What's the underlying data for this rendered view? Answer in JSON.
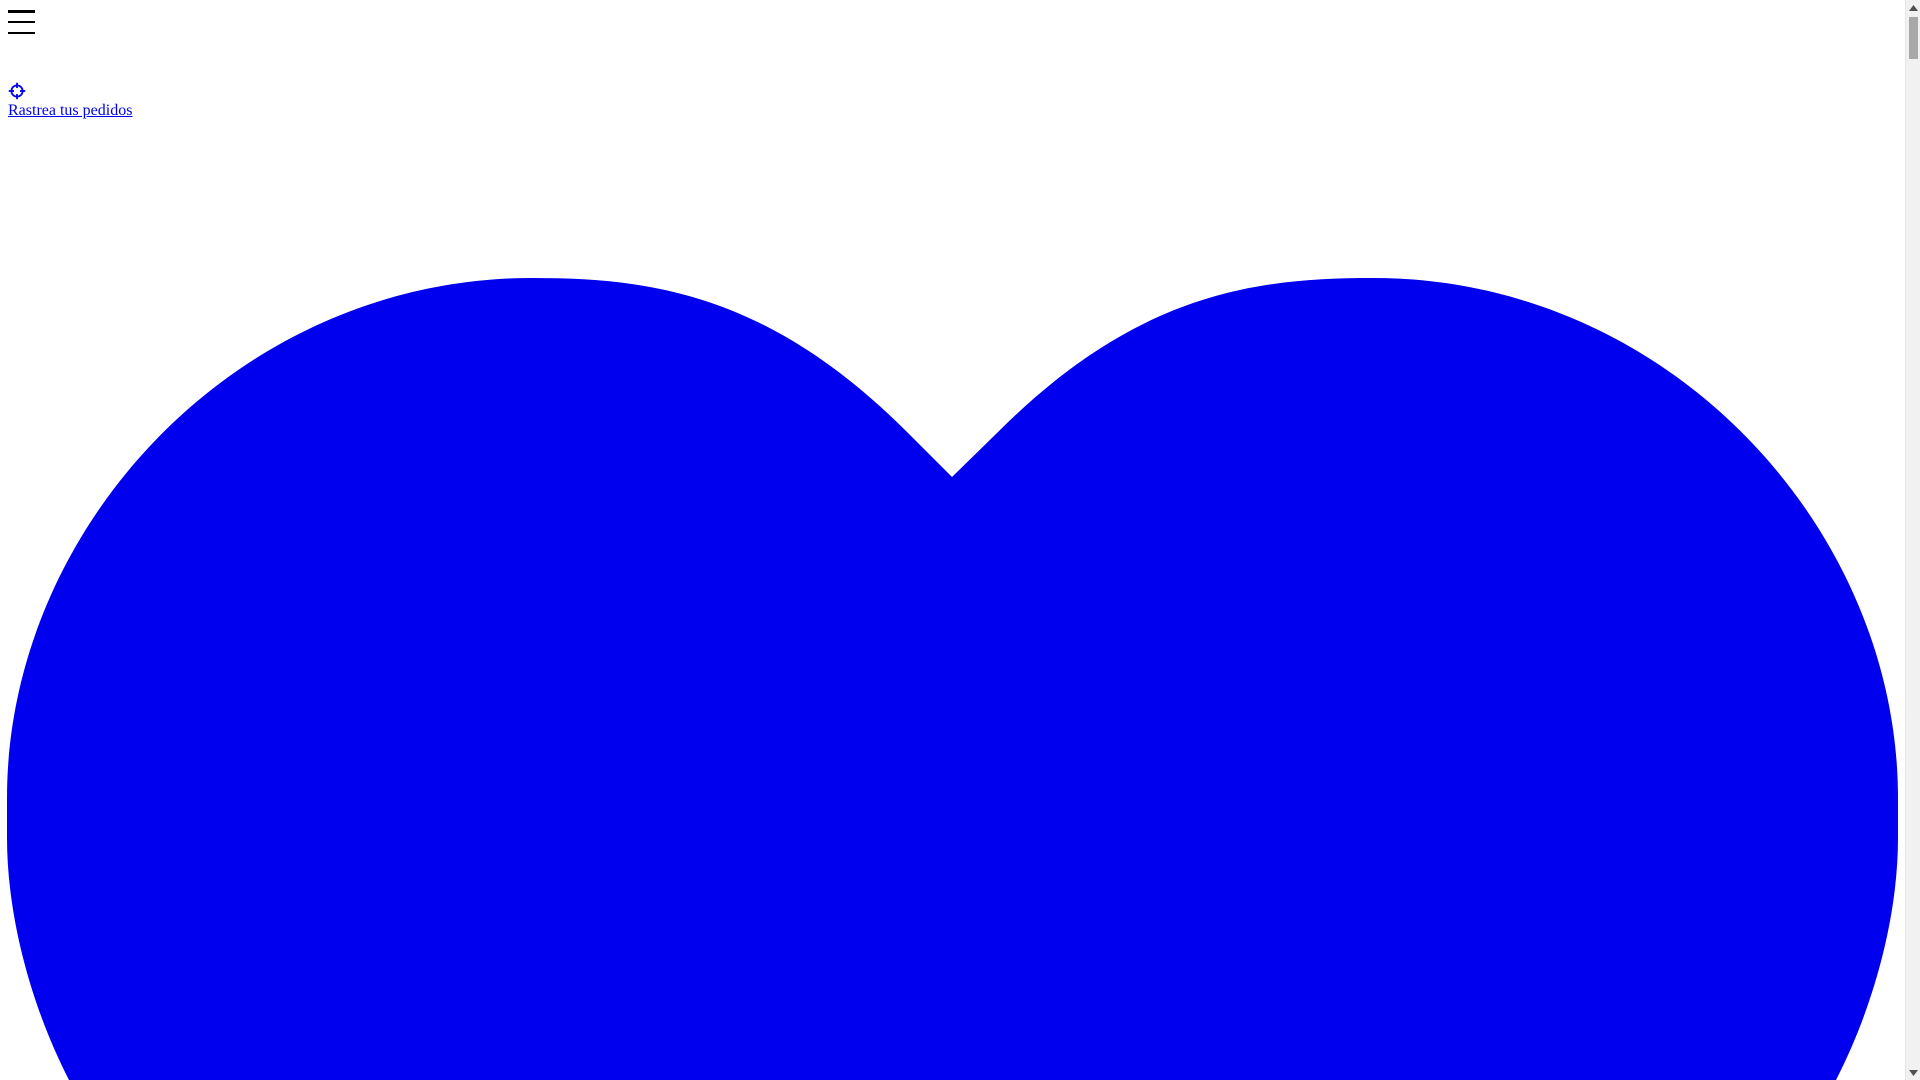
{
  "header": {
    "menu_icon": "hamburger-menu-icon"
  },
  "track_orders": {
    "icon": "crosshair-target-icon",
    "label": "Rastrea tus pedidos"
  },
  "hero": {
    "icon": "heart-icon"
  },
  "colors": {
    "link": "#0000ee",
    "heart": "#0000ee",
    "menu": "#000000",
    "background": "#ffffff",
    "scrollbar_track": "#f1f1f1",
    "scrollbar_thumb": "#a8a8a8"
  }
}
